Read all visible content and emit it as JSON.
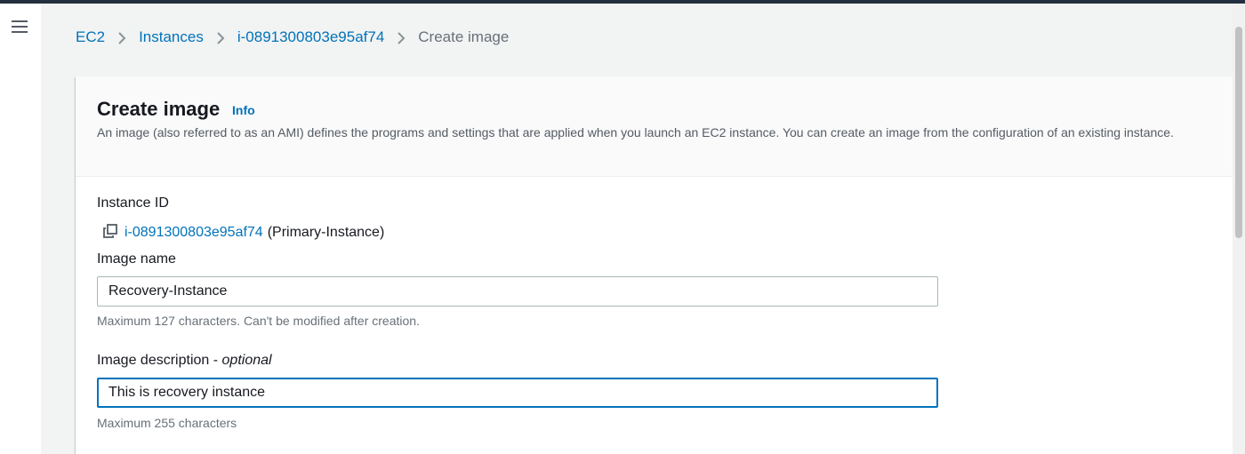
{
  "breadcrumb": {
    "items": [
      "EC2",
      "Instances",
      "i-0891300803e95af74"
    ],
    "current": "Create image"
  },
  "header": {
    "title": "Create image",
    "info_link": "Info",
    "description": "An image (also referred to as an AMI) defines the programs and settings that are applied when you launch an EC2 instance. You can create an image from the configuration of an existing instance."
  },
  "instance": {
    "label": "Instance ID",
    "id": "i-0891300803e95af74",
    "name": "(Primary-Instance)"
  },
  "image_name": {
    "label": "Image name",
    "value": "Recovery-Instance",
    "hint": "Maximum 127 characters. Can't be modified after creation."
  },
  "image_description": {
    "label": "Image description",
    "label_suffix": " - ",
    "optional": "optional",
    "value": "This is recovery instance",
    "hint": "Maximum 255 characters"
  },
  "colors": {
    "link": "#0073bb",
    "topbar": "#232f3e",
    "focus_border": "#0073bb"
  },
  "icons": {
    "menu": "hamburger-menu-icon",
    "separator": "chevron-right-icon",
    "copy": "copy-icon"
  }
}
